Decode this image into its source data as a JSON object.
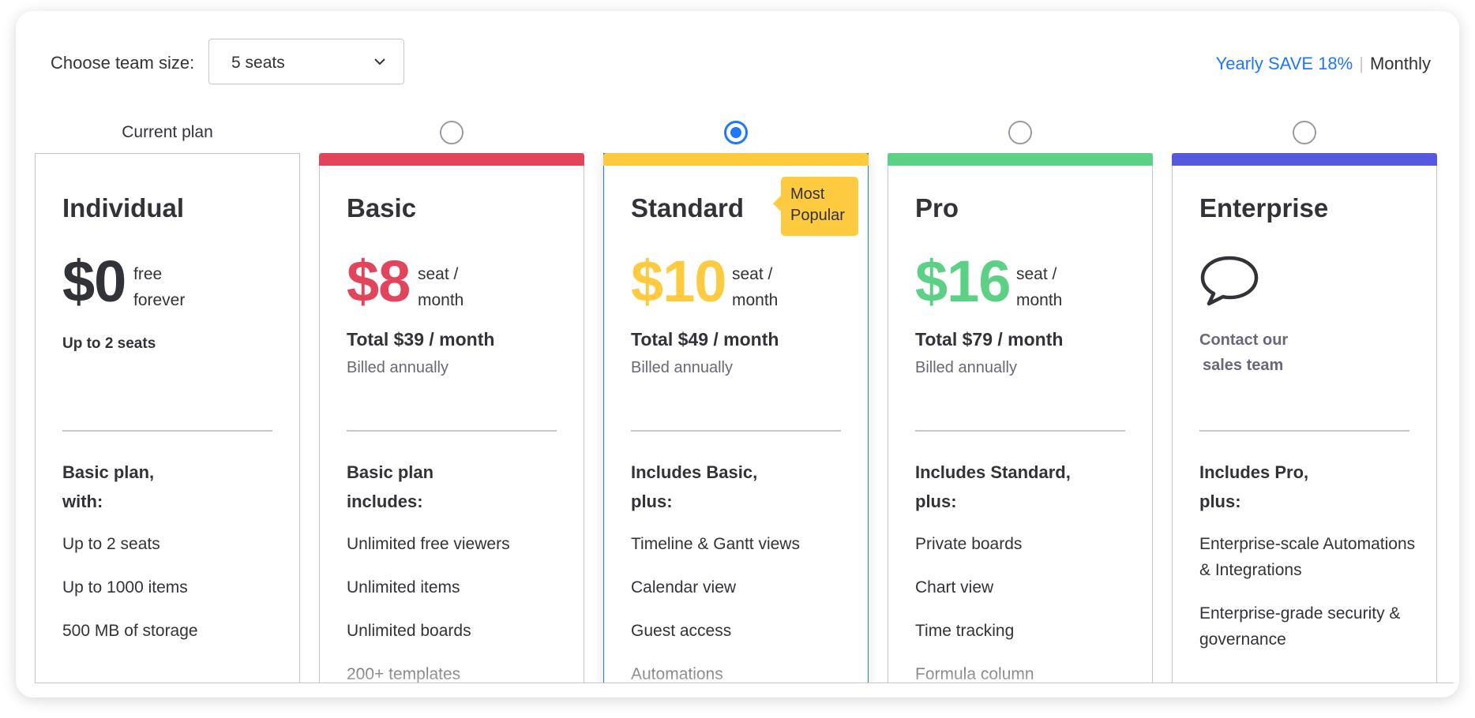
{
  "header": {
    "team_size_label": "Choose team size:",
    "team_size_value": "5 seats",
    "yearly_label": "Yearly SAVE 18%",
    "separator": "|",
    "monthly_label": "Monthly"
  },
  "current_plan_label": "Current plan",
  "selected_plan": "Standard",
  "plans": [
    {
      "name": "Individual",
      "price": "$0",
      "unit_line1": "free",
      "unit_line2": "forever",
      "seats_note": "Up to 2 seats",
      "includes_line1": "Basic plan,",
      "includes_line2": "with:",
      "features": [
        "Up to 2 seats",
        "Up to 1000 items",
        "500 MB of storage"
      ]
    },
    {
      "name": "Basic",
      "color": "#e2445c",
      "price": "$8",
      "unit_line1": "seat /",
      "unit_line2": "month",
      "total": "Total $39 / month",
      "billed": "Billed annually",
      "includes_line1": "Basic plan",
      "includes_line2": "includes:",
      "features": [
        "Unlimited free viewers",
        "Unlimited items",
        "Unlimited boards",
        "200+ templates"
      ]
    },
    {
      "name": "Standard",
      "color": "#fdca40",
      "badge_line1": "Most",
      "badge_line2": "Popular",
      "price": "$10",
      "unit_line1": "seat /",
      "unit_line2": "month",
      "total": "Total $49 / month",
      "billed": "Billed annually",
      "includes_line1": "Includes Basic,",
      "includes_line2": "plus:",
      "features": [
        "Timeline & Gantt views",
        "Calendar view",
        "Guest access",
        "Automations"
      ]
    },
    {
      "name": "Pro",
      "color": "#5cd085",
      "price": "$16",
      "unit_line1": "seat /",
      "unit_line2": "month",
      "total": "Total $79 / month",
      "billed": "Billed annually",
      "includes_line1": "Includes Standard,",
      "includes_line2": "plus:",
      "features": [
        "Private boards",
        "Chart view",
        "Time tracking",
        "Formula column"
      ]
    },
    {
      "name": "Enterprise",
      "color": "#5559df",
      "icon": "chat-bubble-icon",
      "contact_line1": "Contact our",
      "contact_line2": "sales team",
      "includes_line1": "Includes Pro,",
      "includes_line2": "plus:",
      "features": [
        "Enterprise-scale Automations & Integrations",
        "Enterprise-grade security & governance"
      ]
    }
  ],
  "colors": {
    "accent": "#1f76ff",
    "text": "#323338",
    "muted": "#676879",
    "border": "#c5c7d0",
    "price_free": "#323338"
  }
}
